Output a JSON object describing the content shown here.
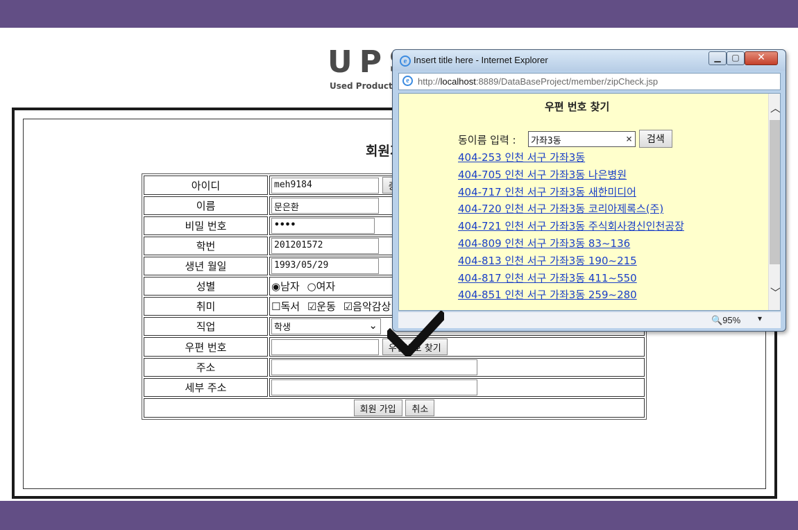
{
  "page": {
    "logo_title": "UPS",
    "logo_subtitle": "Used Product Shop",
    "form_heading": "회원가입"
  },
  "form": {
    "rows": {
      "id": {
        "label": "아이디",
        "value": "meh9184",
        "button": "중복확인"
      },
      "name": {
        "label": "이름",
        "value": "문은환"
      },
      "password": {
        "label": "비밀 번호",
        "value": "••••"
      },
      "student_no": {
        "label": "학번",
        "value": "201201572"
      },
      "birth": {
        "label": "생년 월일",
        "value": "1993/05/29"
      },
      "gender": {
        "label": "성별",
        "options": [
          "남자",
          "여자"
        ],
        "selected": "남자"
      },
      "hobby": {
        "label": "취미",
        "options": [
          "독서",
          "운동",
          "음악감상"
        ],
        "checked": [
          "운동",
          "음악감상"
        ]
      },
      "job": {
        "label": "직업",
        "selected": "학생"
      },
      "zipcode": {
        "label": "우편 번호",
        "value": "",
        "button": "우편번호 찾기"
      },
      "address": {
        "label": "주소",
        "value": ""
      },
      "address_detail": {
        "label": "세부 주소",
        "value": ""
      }
    },
    "submit_label": "회원 가입",
    "cancel_label": "취소"
  },
  "popup": {
    "window_title": "Insert title here - Internet Explorer",
    "url_prefix": "http://",
    "url_host": "localhost",
    "url_rest": ":8889/DataBaseProject/member/zipCheck.jsp",
    "heading": "우편 번호 찾기",
    "search_label": "동이름 입력 :",
    "search_value": "가좌3동",
    "search_button": "검색",
    "results": [
      "404-253 인천 서구 가좌3동",
      "404-705 인천 서구 가좌3동 나은병원",
      "404-717 인천 서구 가좌3동 새한미디어",
      "404-720 인천 서구 가좌3동 코리아제록스(주)",
      "404-721 인천 서구 가좌3동 주식회사경신인천공장",
      "404-809 인천 서구 가좌3동 83~136",
      "404-813 인천 서구 가좌3동 190~215",
      "404-817 인천 서구 가좌3동 411~550",
      "404-851 인천 서구 가좌3동 259~280"
    ],
    "zoom": "95%"
  },
  "colors": {
    "band": "#624e85",
    "popup_bg": "#ffffcc",
    "link": "#1a3fc7"
  }
}
